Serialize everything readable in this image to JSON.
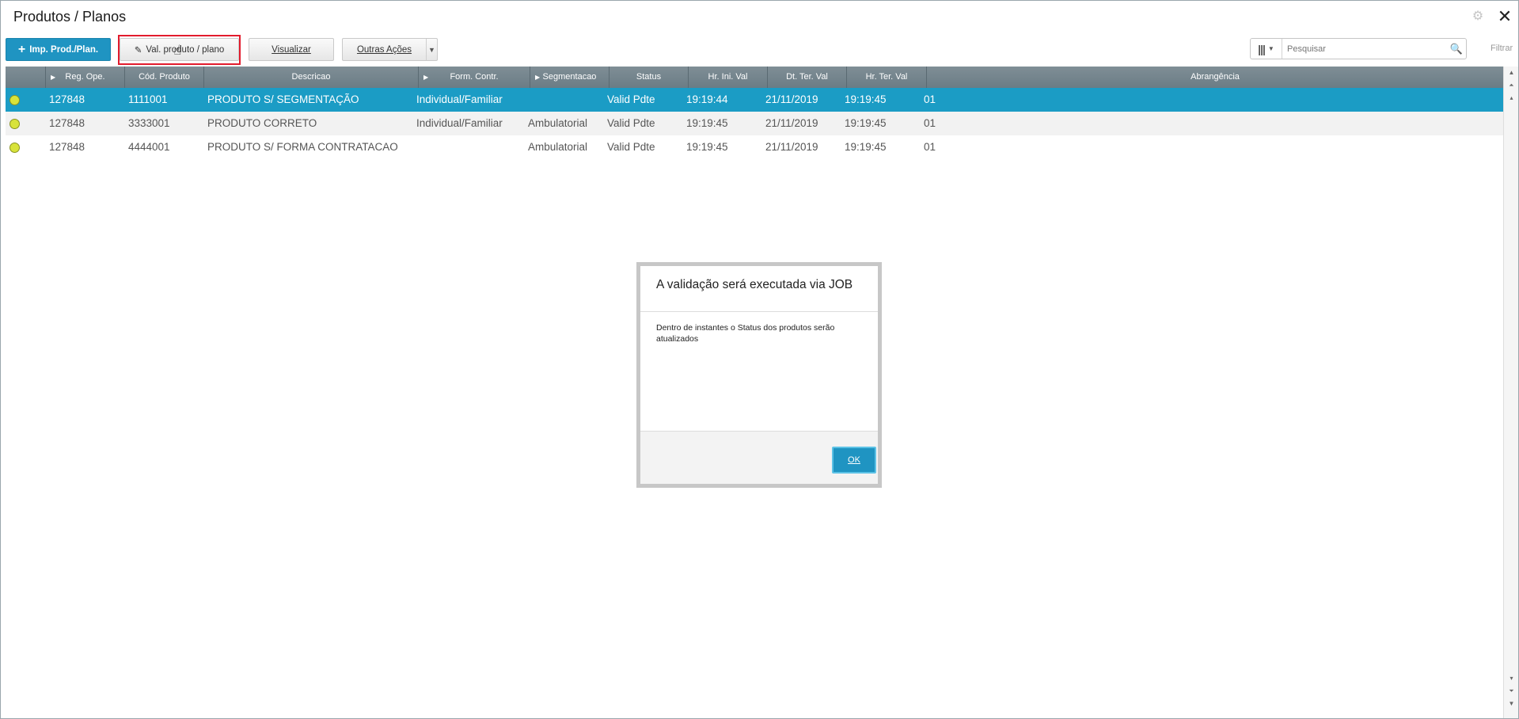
{
  "window": {
    "title": "Produtos / Planos",
    "settings_icon": "gear-icon",
    "close_symbol": "✕"
  },
  "toolbar": {
    "import_label": "Imp. Prod./Plan.",
    "validate_label": "Val. produto / plano",
    "view_label": "Visualizar",
    "other_actions_label": "Outras Ações",
    "search_placeholder": "Pesquisar",
    "filter_label": "Filtrar"
  },
  "grid": {
    "columns": [
      "",
      "Reg. Ope.",
      "Cód. Produto",
      "Descricao",
      "Form. Contr.",
      "Segmentacao",
      "Status",
      "Hr. Ini. Val",
      "Dt. Ter. Val",
      "Hr. Ter. Val",
      "Abrangência"
    ],
    "rows": [
      {
        "reg_ope": "127848",
        "cod_produto": "1111001",
        "descricao": "PRODUTO S/ SEGMENTAÇÃO",
        "form_contr": "Individual/Familiar",
        "segmentacao": "",
        "status": "Valid Pdte",
        "hr_ini_val": "19:19:44",
        "dt_ter_val": "21/11/2019",
        "hr_ter_val": "19:19:45",
        "abrangencia": "01",
        "selected": true
      },
      {
        "reg_ope": "127848",
        "cod_produto": "3333001",
        "descricao": "PRODUTO CORRETO",
        "form_contr": "Individual/Familiar",
        "segmentacao": "Ambulatorial",
        "status": "Valid Pdte",
        "hr_ini_val": "19:19:45",
        "dt_ter_val": "21/11/2019",
        "hr_ter_val": "19:19:45",
        "abrangencia": "01",
        "selected": false
      },
      {
        "reg_ope": "127848",
        "cod_produto": "4444001",
        "descricao": "PRODUTO S/ FORMA CONTRATACAO",
        "form_contr": "",
        "segmentacao": "Ambulatorial",
        "status": "Valid Pdte",
        "hr_ini_val": "19:19:45",
        "dt_ter_val": "21/11/2019",
        "hr_ter_val": "19:19:45",
        "abrangencia": "01",
        "selected": false
      }
    ]
  },
  "dialog": {
    "title": "A validação será executada via JOB",
    "message": "Dentro de instantes o Status dos produtos serão atualizados",
    "ok_label": "OK"
  },
  "colors": {
    "accent": "#1f94c2",
    "selected_row": "#1b9cc5",
    "header": "#748690",
    "status_dot": "#d8e33a",
    "focus_frame": "#e21b2d"
  }
}
